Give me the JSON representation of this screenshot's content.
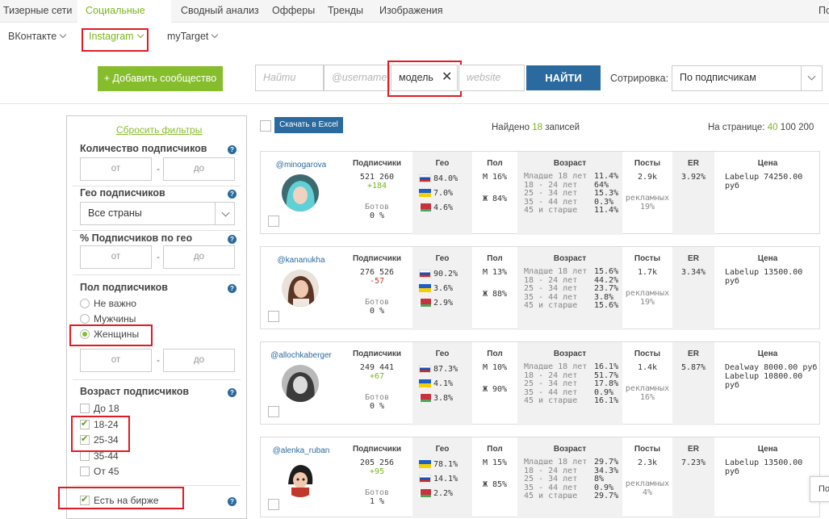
{
  "top_tabs": [
    "Тизерные сети",
    "Социальные сети",
    "Сводный анализ",
    "Офферы",
    "Тренды",
    "Изображения",
    "По"
  ],
  "sub_tabs": [
    "ВКонтакте",
    "Instagram",
    "myTarget"
  ],
  "add_community_label": "+ Добавить сообщество",
  "search": {
    "name_placeholder": "Найти",
    "username_placeholder": "@username",
    "keyword_value": "модель",
    "website_placeholder": "website",
    "submit_label": "НАЙТИ"
  },
  "sort": {
    "label": "Сотрировка:",
    "value": "По подписчикам"
  },
  "filters": {
    "reset_label": "Сбросить фильтры",
    "subs_title": "Количество подписчиков",
    "from": "от",
    "to": "до",
    "geo_title": "Гео подписчиков",
    "geo_value": "Все страны",
    "geo_pct_title": "% Подписчиков по гео",
    "gender_title": "Пол подписчиков",
    "gender_options": [
      "Не важно",
      "Мужчины",
      "Женщины"
    ],
    "age_title": "Возраст подписчиков",
    "age_options": [
      "До 18",
      "18-24",
      "25-34",
      "35-44",
      "От 45"
    ],
    "exchange_label": "Есть на бирже",
    "dash": "-",
    "help": "?"
  },
  "results": {
    "excel_label": "Скачать в Excel",
    "found_prefix": "Найдено",
    "found_count": "18",
    "found_suffix": "записей",
    "per_page_label": "На странице:",
    "per_page_options": [
      "40",
      "100",
      "200"
    ]
  },
  "headers": {
    "subs": "Подписчики",
    "geo": "Гео",
    "gender": "Пол",
    "age": "Возраст",
    "posts": "Посты",
    "er": "ER",
    "price": "Цена",
    "bots": "Ботов",
    "ads": "рекламных"
  },
  "cards": [
    {
      "username": "@minogarova",
      "subs": "521 260",
      "delta": "+184",
      "delta_type": "up",
      "bots": "0 %",
      "geo": [
        "84.0%",
        "7.0%",
        "4.6%"
      ],
      "flags": [
        "ru",
        "ua",
        "by"
      ],
      "male": "М 16%",
      "female": "Ж 84%",
      "ages": [
        "Младше 18 лет",
        "18 - 24 лет",
        "25 - 34 лет",
        "35 - 44 лет",
        "45 и старше"
      ],
      "age_vals": [
        "11.4%",
        "64%",
        "15.3%",
        "0.3%",
        "11.4%"
      ],
      "posts": "2.9k",
      "ads_pct": "19%",
      "er": "3.92%",
      "prices": [
        "Labelup 74250.00 руб"
      ],
      "avatar": "teal"
    },
    {
      "username": "@kananukha",
      "subs": "276 526",
      "delta": "-57",
      "delta_type": "down",
      "bots": "0 %",
      "geo": [
        "90.2%",
        "3.6%",
        "2.9%"
      ],
      "flags": [
        "ru",
        "ua",
        "by"
      ],
      "male": "М 13%",
      "female": "Ж 88%",
      "ages": [
        "Младше 18 лет",
        "18 - 24 лет",
        "25 - 34 лет",
        "35 - 44 лет",
        "45 и старше"
      ],
      "age_vals": [
        "15.6%",
        "44.2%",
        "23.7%",
        "3.8%",
        "15.6%"
      ],
      "posts": "1.7k",
      "ads_pct": "19%",
      "er": "3.34%",
      "prices": [
        "Labelup 13500.00 руб"
      ],
      "avatar": "brown"
    },
    {
      "username": "@allochkaberger",
      "subs": "249 441",
      "delta": "+67",
      "delta_type": "up",
      "bots": "0 %",
      "geo": [
        "87.3%",
        "4.1%",
        "3.8%"
      ],
      "flags": [
        "ru",
        "ua",
        "by"
      ],
      "male": "М 10%",
      "female": "Ж 90%",
      "ages": [
        "Младше 18 лет",
        "18 - 24 лет",
        "25 - 34 лет",
        "35 - 44 лет",
        "45 и старше"
      ],
      "age_vals": [
        "16.1%",
        "51.7%",
        "17.8%",
        "0.9%",
        "16.1%"
      ],
      "posts": "1.4k",
      "ads_pct": "16%",
      "er": "5.87%",
      "prices": [
        "Dealway 8000.00 руб",
        "Labelup 10800.00 руб"
      ],
      "avatar": "gray"
    },
    {
      "username": "@alenka_ruban",
      "subs": "205 256",
      "delta": "+95",
      "delta_type": "up",
      "bots": "1 %",
      "geo": [
        "78.1%",
        "14.1%",
        "2.2%"
      ],
      "flags": [
        "ua",
        "ru",
        "by"
      ],
      "male": "М 15%",
      "female": "Ж 85%",
      "ages": [
        "Младше 18 лет",
        "18 - 24 лет",
        "25 - 34 лет",
        "35 - 44 лет",
        "45 и старше"
      ],
      "age_vals": [
        "29.7%",
        "34.3%",
        "8%",
        "0.9%",
        "29.7%"
      ],
      "posts": "2.3k",
      "ads_pct": "4%",
      "er": "7.23%",
      "prices": [
        "Labelup 13500.00 руб"
      ],
      "avatar": "cartoon"
    }
  ],
  "corner_label": "По",
  "colors": {
    "accent_green": "#86bd2c",
    "accent_blue": "#2b6a9e",
    "highlight_red": "#e01b24"
  }
}
